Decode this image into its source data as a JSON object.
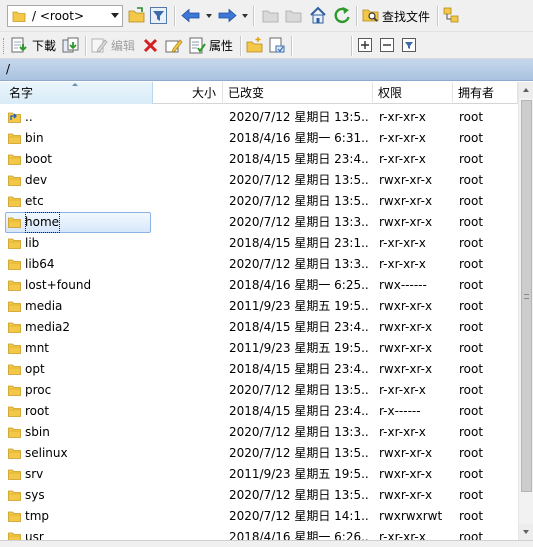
{
  "toolbar": {
    "path_combo": {
      "value": "/ <root>"
    },
    "find_files_label": "查找文件",
    "download_label": "下載",
    "edit_label": "编辑",
    "properties_label": "属性"
  },
  "current_path": "/",
  "columns": {
    "name": "名字",
    "size": "大小",
    "modified": "已改变",
    "permissions": "权限",
    "owner": "拥有者"
  },
  "rows": [
    {
      "name": "..",
      "size": "",
      "modified": "2020/7/12 星期日 13:5...",
      "permissions": "r-xr-xr-x",
      "owner": "root",
      "kind": "parent"
    },
    {
      "name": "bin",
      "size": "",
      "modified": "2018/4/16 星期一 6:31...",
      "permissions": "r-xr-xr-x",
      "owner": "root",
      "kind": "folder"
    },
    {
      "name": "boot",
      "size": "",
      "modified": "2018/4/15 星期日 23:4...",
      "permissions": "r-xr-xr-x",
      "owner": "root",
      "kind": "folder"
    },
    {
      "name": "dev",
      "size": "",
      "modified": "2020/7/12 星期日 13:5...",
      "permissions": "rwxr-xr-x",
      "owner": "root",
      "kind": "folder"
    },
    {
      "name": "etc",
      "size": "",
      "modified": "2020/7/12 星期日 13:5...",
      "permissions": "rwxr-xr-x",
      "owner": "root",
      "kind": "folder"
    },
    {
      "name": "home",
      "size": "",
      "modified": "2020/7/12 星期日 13:3...",
      "permissions": "rwxr-xr-x",
      "owner": "root",
      "kind": "folder",
      "selected": true
    },
    {
      "name": "lib",
      "size": "",
      "modified": "2018/4/15 星期日 23:1...",
      "permissions": "r-xr-xr-x",
      "owner": "root",
      "kind": "folder"
    },
    {
      "name": "lib64",
      "size": "",
      "modified": "2020/7/12 星期日 13:3...",
      "permissions": "r-xr-xr-x",
      "owner": "root",
      "kind": "folder"
    },
    {
      "name": "lost+found",
      "size": "",
      "modified": "2018/4/16 星期一 6:25...",
      "permissions": "rwx------",
      "owner": "root",
      "kind": "folder"
    },
    {
      "name": "media",
      "size": "",
      "modified": "2011/9/23 星期五 19:5...",
      "permissions": "rwxr-xr-x",
      "owner": "root",
      "kind": "folder"
    },
    {
      "name": "media2",
      "size": "",
      "modified": "2018/4/15 星期日 23:4...",
      "permissions": "rwxr-xr-x",
      "owner": "root",
      "kind": "folder"
    },
    {
      "name": "mnt",
      "size": "",
      "modified": "2011/9/23 星期五 19:5...",
      "permissions": "rwxr-xr-x",
      "owner": "root",
      "kind": "folder"
    },
    {
      "name": "opt",
      "size": "",
      "modified": "2018/4/15 星期日 23:4...",
      "permissions": "rwxr-xr-x",
      "owner": "root",
      "kind": "folder"
    },
    {
      "name": "proc",
      "size": "",
      "modified": "2020/7/12 星期日 13:5...",
      "permissions": "r-xr-xr-x",
      "owner": "root",
      "kind": "folder"
    },
    {
      "name": "root",
      "size": "",
      "modified": "2018/4/15 星期日 23:4...",
      "permissions": "r-x------",
      "owner": "root",
      "kind": "folder"
    },
    {
      "name": "sbin",
      "size": "",
      "modified": "2020/7/12 星期日 13:3...",
      "permissions": "r-xr-xr-x",
      "owner": "root",
      "kind": "folder"
    },
    {
      "name": "selinux",
      "size": "",
      "modified": "2020/7/12 星期日 13:5...",
      "permissions": "rwxr-xr-x",
      "owner": "root",
      "kind": "folder"
    },
    {
      "name": "srv",
      "size": "",
      "modified": "2011/9/23 星期五 19:5...",
      "permissions": "rwxr-xr-x",
      "owner": "root",
      "kind": "folder"
    },
    {
      "name": "sys",
      "size": "",
      "modified": "2020/7/12 星期日 13:5...",
      "permissions": "rwxr-xr-x",
      "owner": "root",
      "kind": "folder"
    },
    {
      "name": "tmp",
      "size": "",
      "modified": "2020/7/12 星期日 14:1...",
      "permissions": "rwxrwxrwt",
      "owner": "root",
      "kind": "folder"
    },
    {
      "name": "usr",
      "size": "",
      "modified": "2018/4/16 星期一 6:26...",
      "permissions": "r-xr-xr-x",
      "owner": "root",
      "kind": "folder"
    }
  ],
  "colors": {
    "pathbar": "#b5cbe5",
    "selection_border": "#8bb3e3",
    "folder_yellow": "#f3c747"
  }
}
